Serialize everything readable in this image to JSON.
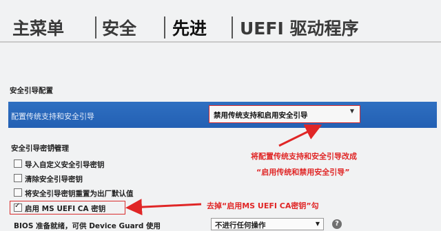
{
  "tabs": [
    {
      "label": "主菜单"
    },
    {
      "label": "安全"
    },
    {
      "label": "先进"
    },
    {
      "label": "UEFI 驱动程序"
    }
  ],
  "secure_boot": {
    "section_title": "安全引导配置",
    "legacy_row": {
      "label": "配置传统支持和安全引导",
      "value": "禁用传统支持和启用安全引导"
    }
  },
  "key_management": {
    "title": "安全引导密钥管理",
    "options": [
      {
        "label": "导入自定义安全引导密钥",
        "checked": false
      },
      {
        "label": "清除安全引导密钥",
        "checked": false
      },
      {
        "label": "将安全引导密钥重置为出厂默认值",
        "checked": false
      },
      {
        "label": "启用 MS UEFI CA 密钥",
        "checked": true
      }
    ]
  },
  "bios_row": {
    "label": "BIOS 准备就绪，可供 Device Guard 使用",
    "value": "不进行任何操作"
  },
  "annotations": {
    "note1_line1": "将配置传统支持和安全引导改成",
    "note1_line2": "“启用传统和禁用安全引导”",
    "note2": "去掉“启用MS UEFI CA密钥”勾"
  },
  "colors": {
    "highlight": "#2a66ba",
    "annotation": "#e02626"
  },
  "icons": {
    "select_arrow": "chevron-down-icon",
    "help": "help-icon",
    "cursor": "mouse-cursor-icon"
  }
}
